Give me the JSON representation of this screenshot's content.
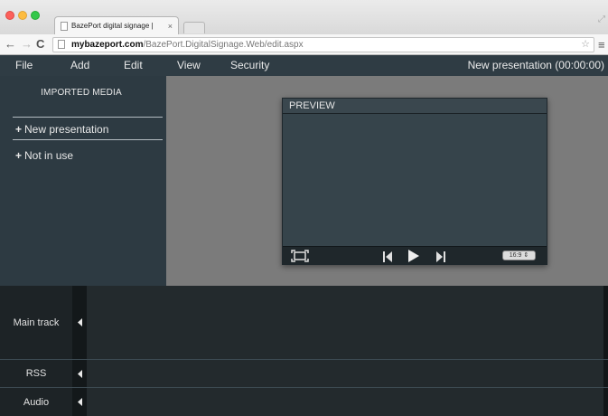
{
  "browser": {
    "tab_title": "BazePort digital signage | ",
    "tab_close": "×",
    "url_host": "mybazeport.com",
    "url_path": "/BazePort.DigitalSignage.Web/edit.aspx",
    "nav_back": "←",
    "nav_forward": "→",
    "nav_reload": "C",
    "bookmark_star": "☆",
    "menu_glyph": "≡"
  },
  "menubar": {
    "items": [
      "File",
      "Add",
      "Edit",
      "View",
      "Security"
    ],
    "presentation_title": "New presentation (00:00:00)"
  },
  "sidebar": {
    "heading": "IMPORTED MEDIA",
    "items": [
      {
        "icon": "+",
        "label": "New presentation"
      },
      {
        "icon": "+",
        "label": "Not in use"
      }
    ]
  },
  "preview": {
    "title": "PREVIEW",
    "aspect_ratio": "16:9 ⇕"
  },
  "timeline": {
    "tracks": [
      "Main track",
      "RSS",
      "Audio"
    ]
  },
  "colors": {
    "menubar_bg": "#2f3c44",
    "sidebar_bg": "#2d3a42",
    "stage_bg": "#7b7b7b",
    "timeline_bg": "#1d2326"
  },
  "icons": {
    "fullscreen": "fullscreen-icon",
    "previous": "skip-previous-icon",
    "play": "play-icon",
    "next": "skip-next-icon",
    "collapse": "caret-left-icon"
  }
}
